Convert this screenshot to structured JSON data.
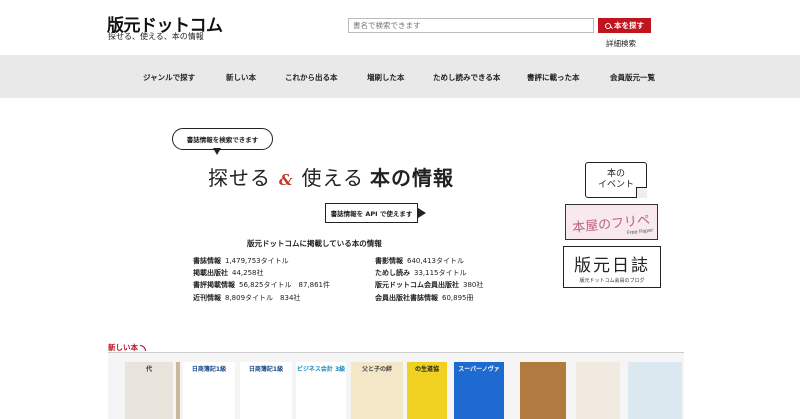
{
  "header": {
    "logo_main": "版元",
    "logo_sub": "ドットコム",
    "tagline": "探せる、使える、本の情報",
    "search_placeholder": "書名で検索できます",
    "search_button": "本を探す",
    "advanced_search": "詳細検索"
  },
  "nav": {
    "items": [
      {
        "label": "ジャンルで探す"
      },
      {
        "label": "新しい本"
      },
      {
        "label": "これから出る本"
      },
      {
        "label": "増刷した本"
      },
      {
        "label": "ためし読みできる本"
      },
      {
        "label": "書評に載った本"
      },
      {
        "label": "会員版元一覧"
      }
    ]
  },
  "hero": {
    "bubble_top": "書誌情報を検索できます",
    "headline_a": "探せる",
    "headline_amp": "&",
    "headline_b": "使える",
    "headline_c": "本の情報",
    "bubble_api": "書誌情報を API で使えます"
  },
  "stats": {
    "title": "版元ドットコムに掲載している本の情報",
    "left": [
      {
        "label": "書誌情報",
        "value": "1,479,753タイトル"
      },
      {
        "label": "掲載出版社",
        "value": "44,258社"
      },
      {
        "label": "書評掲載情報",
        "value": "56,825タイトル　87,861件"
      },
      {
        "label": "近刊情報",
        "value": "8,809タイトル　834社"
      }
    ],
    "right": [
      {
        "label": "書影情報",
        "value": "640,413タイトル"
      },
      {
        "label": "ためし読み",
        "value": "33,115タイトル"
      },
      {
        "label": "版元ドットコム会員出版社",
        "value": "380社"
      },
      {
        "label": "会員出版社書誌情報",
        "value": "60,895冊"
      }
    ]
  },
  "banners": {
    "event_line1": "本の",
    "event_line2": "イベント",
    "furipe": "本屋のフリペ",
    "furipe_sub": "Free Paper",
    "nisshi": "版元日誌",
    "nisshi_sub": "版元ドットコム会員のブログ"
  },
  "new_books": {
    "title": "新しい本",
    "books": [
      {
        "text": "代",
        "bg": "#e8e4dc",
        "color": "#333"
      },
      {
        "text": "",
        "bg": "#c9b9a0",
        "color": "#333"
      },
      {
        "text": "日商簿記1級",
        "bg": "#ffffff",
        "color": "#1a4a8a"
      },
      {
        "text": "日商簿記1級",
        "bg": "#ffffff",
        "color": "#1a4a8a"
      },
      {
        "text": "ビジネス会計 3級",
        "bg": "#ffffff",
        "color": "#1a8ac0"
      },
      {
        "text": "父と子の絆",
        "bg": "#f3e7c8",
        "color": "#444"
      },
      {
        "text": "の生道協",
        "bg": "#f0d020",
        "color": "#222"
      },
      {
        "text": "スーパーノヴァ",
        "bg": "#1e6ad0",
        "color": "#fff"
      },
      {
        "text": "",
        "bg": "#b07a40",
        "color": "#fff"
      },
      {
        "text": "",
        "bg": "#f0eae0",
        "color": "#333"
      },
      {
        "text": "",
        "bg": "#dce8f0",
        "color": "#333"
      }
    ]
  }
}
